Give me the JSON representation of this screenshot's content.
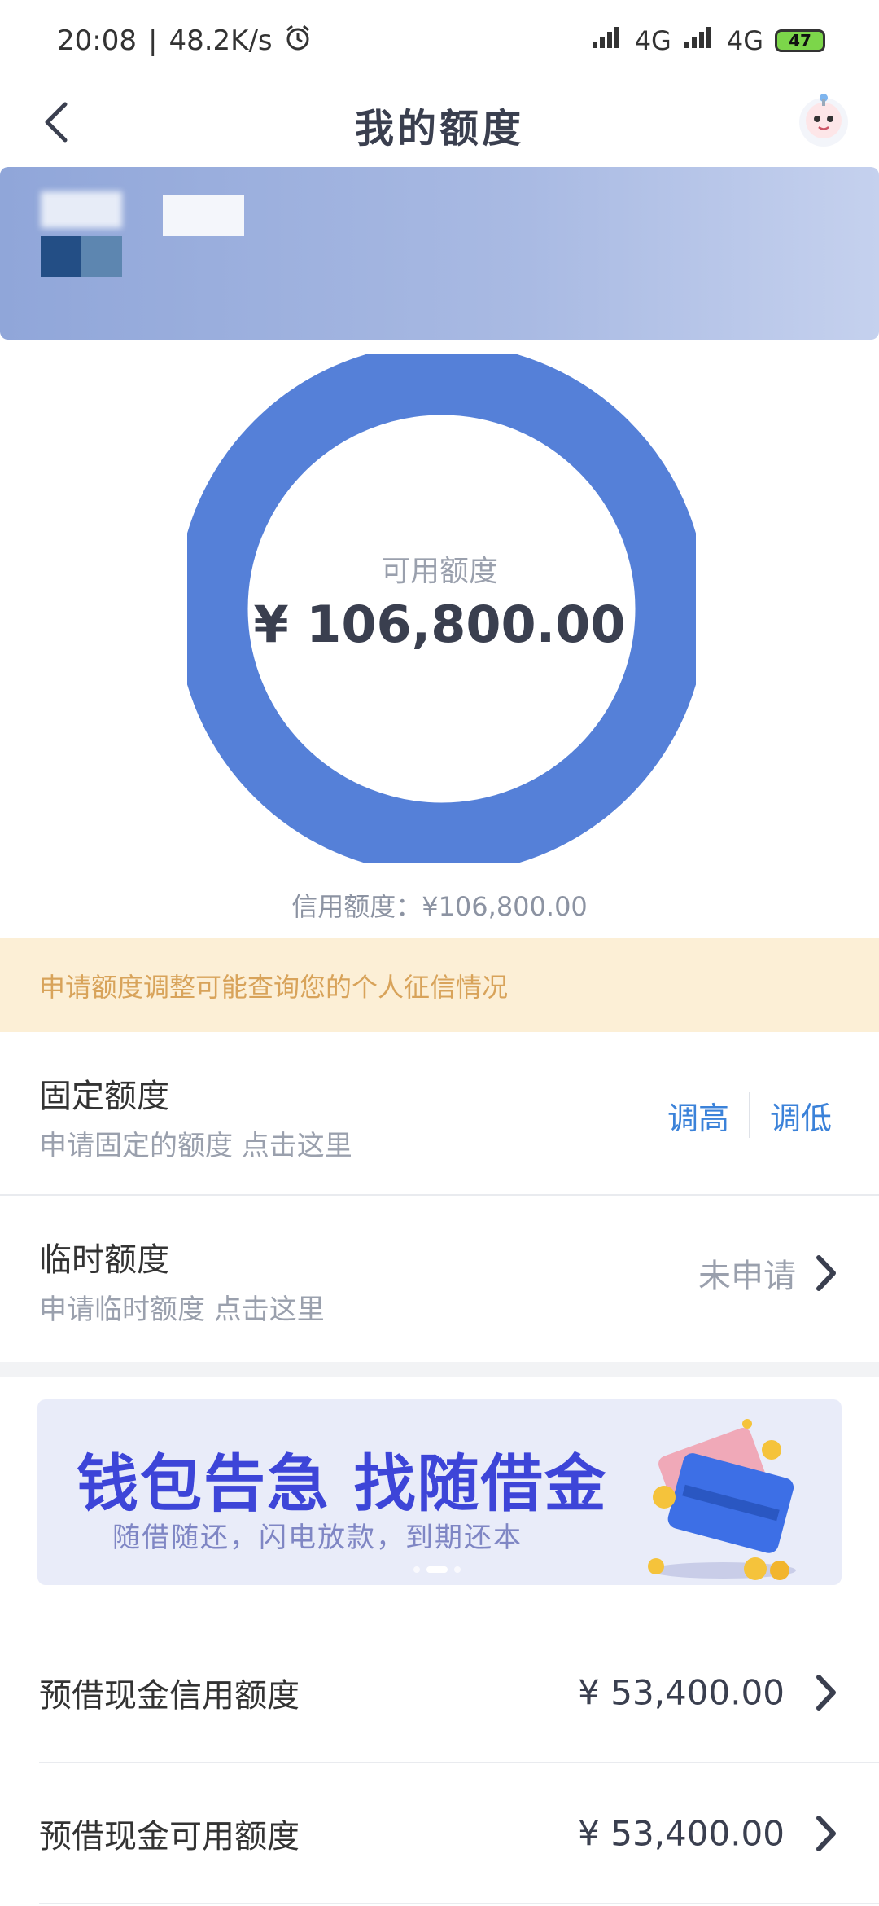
{
  "status_bar": {
    "time": "20:08",
    "speed": "48.2K/s",
    "network1": "4G",
    "network2": "4G",
    "battery": "47"
  },
  "header": {
    "title": "我的额度"
  },
  "summary": {
    "available_label": "可用额度",
    "available_amount": "¥ 106,800.00",
    "credit_limit_text": "信用额度：¥106,800.00",
    "available_ratio": 1.0,
    "ring_color": "#5580d8"
  },
  "notice": {
    "text": "申请额度调整可能查询您的个人征信情况"
  },
  "fixed_limit": {
    "title": "固定额度",
    "subtitle": "申请固定的额度 点击这里",
    "raise_label": "调高",
    "lower_label": "调低"
  },
  "temp_limit": {
    "title": "临时额度",
    "subtitle": "申请临时额度 点击这里",
    "status": "未申请"
  },
  "promo": {
    "title": "钱包告急 找随借金",
    "subtitle": "随借随还，闪电放款，到期还本"
  },
  "cash_rows": [
    {
      "label": "预借现金信用额度",
      "value": "¥ 53,400.00"
    },
    {
      "label": "预借现金可用额度",
      "value": "¥ 53,400.00"
    }
  ],
  "colors": {
    "accent_blue": "#3b82d9",
    "notice_bg": "#fcefd6",
    "notice_text": "#d8a35a"
  }
}
